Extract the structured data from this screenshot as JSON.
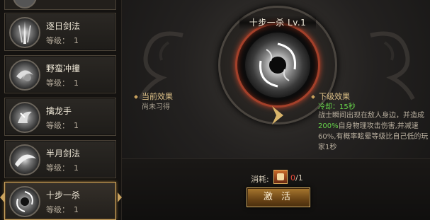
{
  "skills": [
    {
      "name": "逐日剑法",
      "level_label": "等级：",
      "level": "1",
      "selected": false
    },
    {
      "name": "野蛮冲撞",
      "level_label": "等级：",
      "level": "1",
      "selected": false
    },
    {
      "name": "擒龙手",
      "level_label": "等级：",
      "level": "1",
      "selected": false
    },
    {
      "name": "半月剑法",
      "level_label": "等级：",
      "level": "1",
      "selected": false
    },
    {
      "name": "十步一杀",
      "level_label": "等级：",
      "level": "1",
      "selected": true
    }
  ],
  "detail": {
    "title": "十步一杀 Lv.1",
    "current_effect": {
      "title": "当前效果",
      "text": "尚未习得"
    },
    "next_effect": {
      "title": "下级效果",
      "cooldown": "冷却：15秒",
      "desc_line1": "战士瞬间出现在敌人身边，并造成",
      "desc_percent": "200%",
      "desc_line2": "自身物理攻击伤害,并减速",
      "desc_line3": "60%,有概率眩晕等级比自己低的玩家1秒"
    }
  },
  "cost": {
    "label": "消耗:",
    "have": "0",
    "need": "/1"
  },
  "activate_label": "激 活",
  "colors": {
    "accent_gold": "#c9a25e",
    "ring_red": "#a3402a",
    "highlight_green": "#66d14a",
    "cost_red": "#e44a3a"
  }
}
